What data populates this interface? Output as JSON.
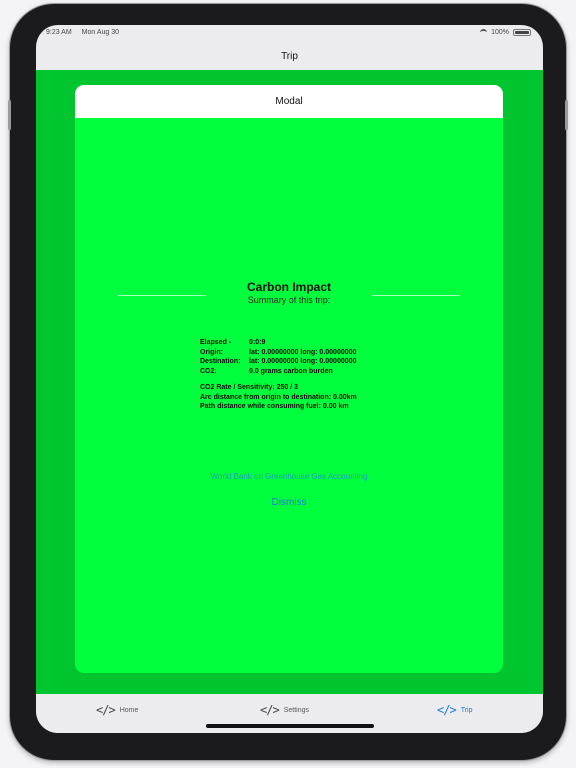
{
  "status": {
    "time": "9:23 AM",
    "date": "Mon Aug 30",
    "battery": "100%"
  },
  "nav": {
    "title": "Trip"
  },
  "modal": {
    "header": "Modal",
    "title": "Carbon Impact",
    "subtitle": "Summary of this trip:",
    "rows": [
      {
        "key": "Elapsed -",
        "value": "0:0:9"
      },
      {
        "key": "Origin:",
        "value": "lat: 0.00000000 long: 0.00000000"
      },
      {
        "key": "Destination:",
        "value": "lat: 0.00000000 long: 0.00000000"
      },
      {
        "key": "CO2:",
        "value": "0.0 grams carbon burden"
      }
    ],
    "extra": [
      "CO2 Rate / Sensitivity: 250 / 3",
      "Arc distance from origin to destination: 0.00km",
      "Path distance while consuming fuel: 0.00 km"
    ],
    "link": "World Bank on Greenhouse Gas Accounting",
    "dismiss": "Dismiss"
  },
  "tabs": [
    {
      "label": "Home",
      "icon": "code-icon"
    },
    {
      "label": "Settings",
      "icon": "code-icon"
    },
    {
      "label": "Trip",
      "icon": "code-icon",
      "active": true
    }
  ],
  "colors": {
    "accent": "#1b7ad9",
    "modal_bg": "#00ff3c",
    "backdrop": "#00c52e"
  }
}
